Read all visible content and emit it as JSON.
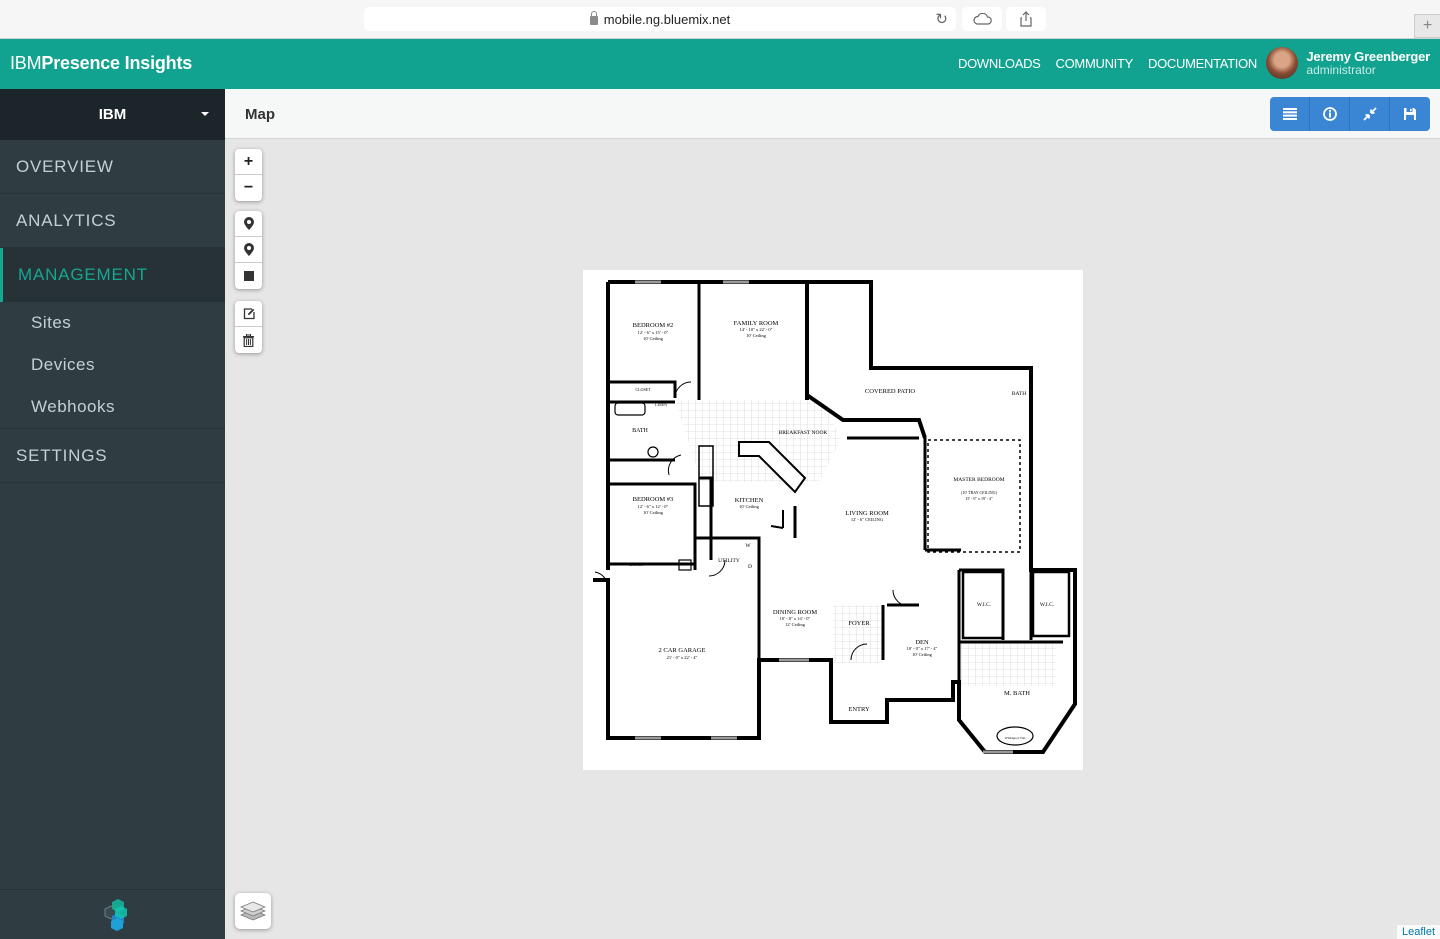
{
  "browser": {
    "url": "mobile.ng.bluemix.net"
  },
  "header": {
    "brand_ibm": "IBM",
    "brand_product": "Presence Insights",
    "nav": [
      "DOWNLOADS",
      "COMMUNITY",
      "DOCUMENTATION"
    ],
    "user_name": "Jeremy Greenberger",
    "user_role": "administrator"
  },
  "sidebar": {
    "org": "IBM",
    "items": [
      {
        "label": "OVERVIEW"
      },
      {
        "label": "ANALYTICS"
      },
      {
        "label": "MANAGEMENT"
      },
      {
        "label": "SETTINGS"
      }
    ],
    "sub_items": [
      {
        "label": "Sites"
      },
      {
        "label": "Devices"
      },
      {
        "label": "Webhooks"
      }
    ]
  },
  "page": {
    "title": "Map"
  },
  "map": {
    "attribution": "Leaflet",
    "floorplan_labels": {
      "bedroom2": "BEDROOM #2",
      "bedroom2_dim": "12' - 6\" x 15' - 0\"",
      "family_room": "FAMILY ROOM",
      "family_room_dim": "14' - 10\" x 22' - 0\"",
      "covered_patio": "COVERED PATIO",
      "bath": "BATH",
      "closet": "CLOSET",
      "linen": "LINEN",
      "breakfast_nook": "BREAKFAST NOOK",
      "master_bedroom": "MASTER BEDROOM",
      "master_bedroom_dim": "15' - 0\" x 19' - 4\"",
      "bedroom3": "BEDROOM #3",
      "bedroom3_dim": "12' - 6\" x 12' - 0\"",
      "kitchen": "KITCHEN",
      "living_room": "LIVING ROOM",
      "living_room_dim": "12' - 6\" CEILING",
      "utility": "UTILITY",
      "wic": "W.I.C.",
      "garage": "2 CAR GARAGE",
      "garage_dim": "21' - 0\" x 22' - 4\"",
      "dining_room": "DINING ROOM",
      "dining_room_dim": "10' - 8\" x 14' - 0\"",
      "foyer": "FOYER",
      "den": "DEN",
      "den_dim": "10' - 0\" x 17' - 4\"",
      "m_bath": "M. BATH",
      "entry": "ENTRY",
      "ceiling_10": "10' Ceiling",
      "ceiling_12": "12' Ceiling",
      "tray_ceiling": "(10' TRAY CEILING)",
      "w": "W",
      "d": "D",
      "whirlpool": "Whirlpool Tub"
    }
  }
}
